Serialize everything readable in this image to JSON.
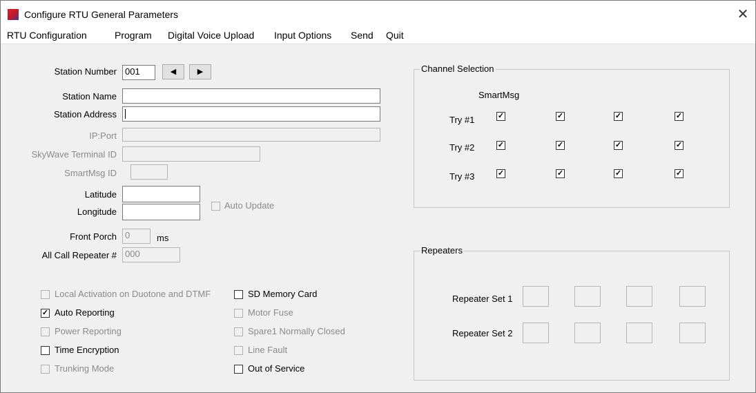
{
  "window": {
    "title": "Configure RTU General Parameters",
    "close_glyph": "✕"
  },
  "menu": [
    "RTU Configuration",
    "Program",
    "Digital Voice Upload",
    "Input Options",
    "Send",
    "Quit"
  ],
  "form": {
    "station_number_label": "Station Number",
    "station_number_value": "001",
    "prev_glyph": "◀",
    "next_glyph": "▶",
    "station_name_label": "Station Name",
    "station_name_value": "",
    "station_address_label": "Station Address",
    "station_address_value": "",
    "ip_port_label": "IP:Port",
    "ip_port_value": "",
    "skywave_label": "SkyWave Terminal ID",
    "skywave_value": "",
    "smartmsg_id_label": "SmartMsg ID",
    "smartmsg_id_value": "",
    "latitude_label": "Latitude",
    "latitude_value": "",
    "longitude_label": "Longitude",
    "longitude_value": "",
    "auto_update_label": "Auto Update",
    "front_porch_label": "Front Porch",
    "front_porch_value": "0",
    "front_porch_unit": "ms",
    "all_call_label": "All Call Repeater #",
    "all_call_value": "000"
  },
  "checkboxes": {
    "local_activation": {
      "label": "Local Activation on Duotone and DTMF",
      "checked": false,
      "enabled": false
    },
    "auto_reporting": {
      "label": "Auto Reporting",
      "checked": true,
      "enabled": true
    },
    "power_reporting": {
      "label": "Power Reporting",
      "checked": false,
      "enabled": false
    },
    "time_encryption": {
      "label": "Time Encryption",
      "checked": false,
      "enabled": true
    },
    "trunking_mode": {
      "label": "Trunking Mode",
      "checked": false,
      "enabled": false
    },
    "sd_memory_card": {
      "label": "SD Memory Card",
      "checked": false,
      "enabled": true
    },
    "motor_fuse": {
      "label": "Motor Fuse",
      "checked": false,
      "enabled": false
    },
    "spare1": {
      "label": "Spare1 Normally Closed",
      "checked": false,
      "enabled": false
    },
    "line_fault": {
      "label": "Line Fault",
      "checked": false,
      "enabled": false
    },
    "out_of_service": {
      "label": "Out of Service",
      "checked": false,
      "enabled": true
    }
  },
  "channel_selection": {
    "title": "Channel Selection",
    "column_header": "SmartMsg",
    "rows": [
      {
        "label": "Try #1",
        "checked": [
          true,
          true,
          true,
          true
        ]
      },
      {
        "label": "Try #2",
        "checked": [
          true,
          true,
          true,
          true
        ]
      },
      {
        "label": "Try #3",
        "checked": [
          true,
          true,
          true,
          true
        ]
      }
    ]
  },
  "repeaters": {
    "title": "Repeaters",
    "set1_label": "Repeater Set 1",
    "set2_label": "Repeater Set 2"
  },
  "colors": {
    "accent_red": "#d8232a",
    "accent_blue": "#3c3a8f",
    "disabled_text": "#8a8a8a",
    "window_bg": "#f0f0f0"
  }
}
